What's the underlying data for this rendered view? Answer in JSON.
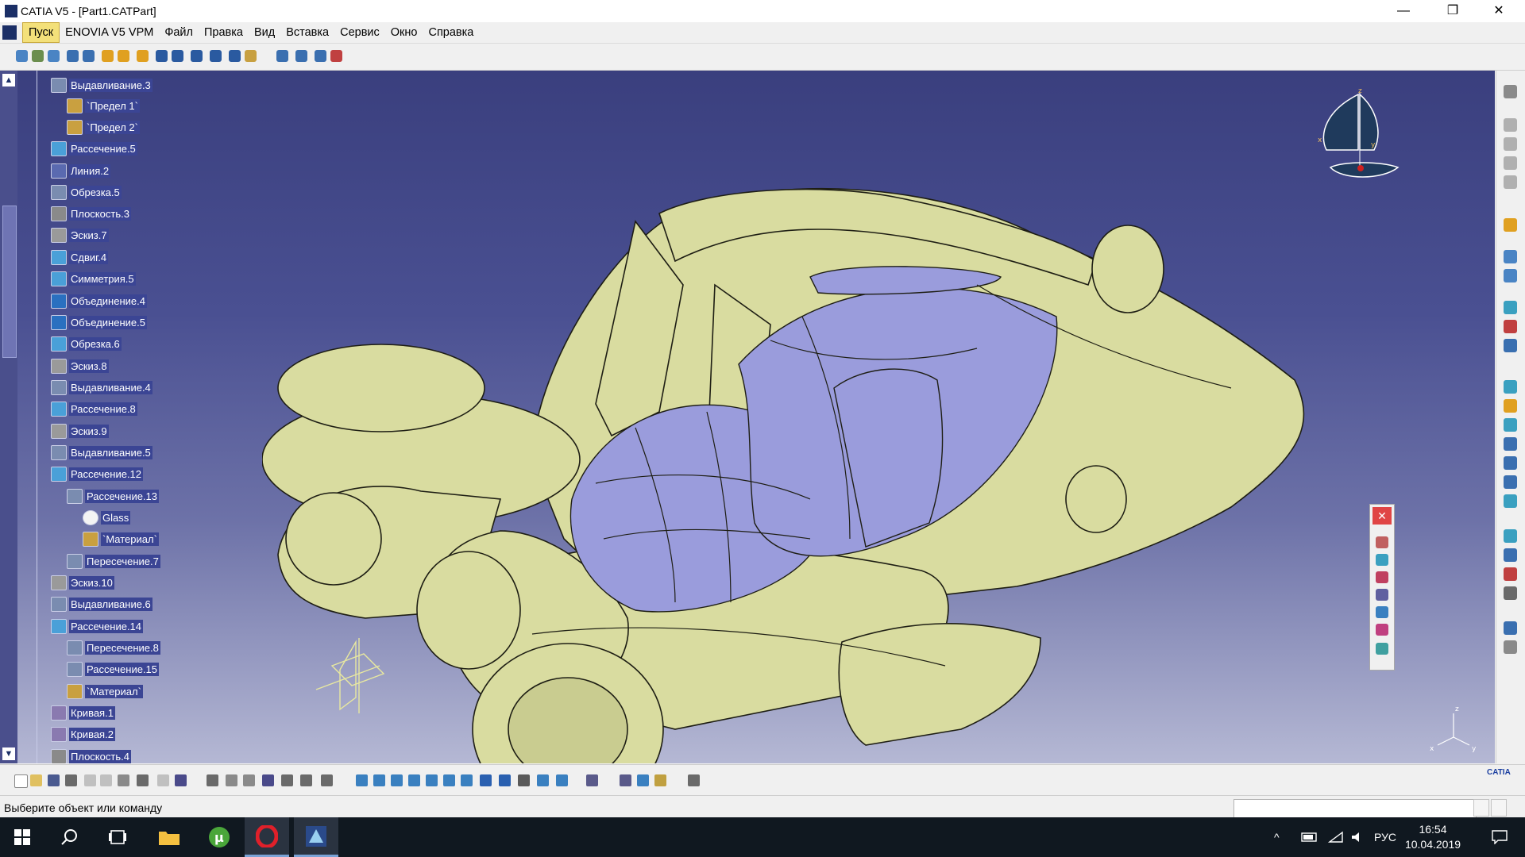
{
  "window": {
    "title": "CATIA V5 - [Part1.CATPart]",
    "minimize": "—",
    "restore": "❐",
    "close": "✕"
  },
  "menu": [
    "Пуск",
    "ENOVIA V5 VPM",
    "Файл",
    "Правка",
    "Вид",
    "Вставка",
    "Сервис",
    "Окно",
    "Справка"
  ],
  "tree": [
    "Выдавливание.3",
    "`Предел 1`",
    "`Предел 2`",
    "Рассечение.5",
    "Линия.2",
    "Обрезка.5",
    "Плоскость.3",
    "Эскиз.7",
    "Сдвиг.4",
    "Симметрия.5",
    "Объединение.4",
    "Объединение.5",
    "Обрезка.6",
    "Эскиз.8",
    "Выдавливание.4",
    "Рассечение.8",
    "Эскиз.9",
    "Выдавливание.5",
    "Рассечение.12",
    "Рассечение.13",
    "Glass",
    "`Материал`",
    "Пересечение.7",
    "Эскиз.10",
    "Выдавливание.6",
    "Рассечение.14",
    "Пересечение.8",
    "Рассечение.15",
    "`Материал`",
    "Кривая.1",
    "Кривая.2",
    "Плоскость.4"
  ],
  "colors": {
    "tree_label_bg": "#3b4594",
    "model": "#d9dca0",
    "glass": "#9a9cdc"
  },
  "compass": {
    "x": "x",
    "y": "y",
    "z": "z"
  },
  "axis_triad": {
    "x": "x",
    "y": "y",
    "z": "z"
  },
  "floating_panel": {
    "close": "✕"
  },
  "status": {
    "text": "Выберите объект или команду",
    "command_value": ""
  },
  "catia_logo": "CATIA",
  "taskbar": {
    "apps": [
      "start-icon",
      "search-icon",
      "task-view-icon",
      "file-explorer-icon",
      "utorrent-icon",
      "opera-icon",
      "catia-icon"
    ],
    "tray_chevron": "^",
    "lang": "РУС",
    "time": "16:54",
    "date": "10.04.2019"
  }
}
